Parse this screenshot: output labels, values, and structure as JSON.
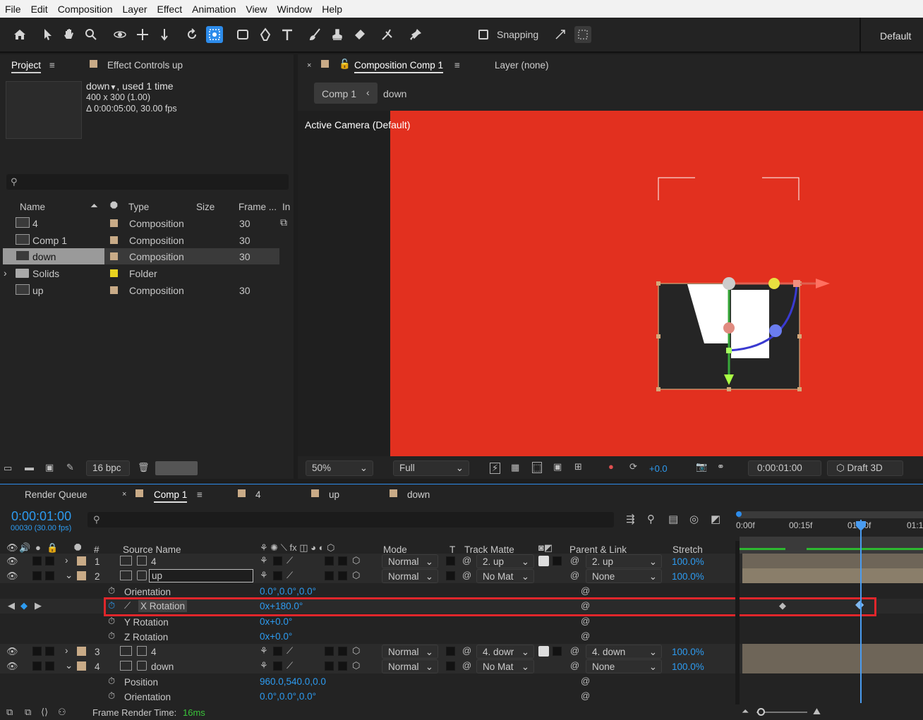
{
  "menu": [
    "File",
    "Edit",
    "Composition",
    "Layer",
    "Effect",
    "Animation",
    "View",
    "Window",
    "Help"
  ],
  "toolbar": {
    "snapping_label": "Snapping",
    "workspace": "Default"
  },
  "project": {
    "tab_label": "Project",
    "effect_tab_label": "Effect Controls up",
    "item_name": "down",
    "item_used": ", used 1 time",
    "item_dims": "400 x 300 (1.00)",
    "item_duration": "Δ 0:00:05:00, 30.00 fps",
    "col_name": "Name",
    "col_type": "Type",
    "col_size": "Size",
    "col_frame": "Frame ...",
    "col_in": "In",
    "items": [
      {
        "name": "4",
        "type": "Composition",
        "frame": "30",
        "color": "#c9ab87"
      },
      {
        "name": "Comp 1",
        "type": "Composition",
        "frame": "30",
        "color": "#c9ab87"
      },
      {
        "name": "down",
        "type": "Composition",
        "frame": "30",
        "color": "#c9ab87"
      },
      {
        "name": "Solids",
        "type": "Folder",
        "frame": "",
        "color": "#e8d21f"
      },
      {
        "name": "up",
        "type": "Composition",
        "frame": "30",
        "color": "#c9ab87"
      }
    ],
    "bpc": "16 bpc"
  },
  "viewer": {
    "tab_label": "Composition Comp 1",
    "layer_tab": "Layer (none)",
    "breadcrumb_comp": "Comp 1",
    "breadcrumb_sub": "down",
    "camera_label": "Active Camera (Default)",
    "zoom": "50%",
    "resolution": "Full",
    "exposure": "+0.0",
    "timecode": "0:00:01:00",
    "renderer": "Draft 3D",
    "bg_color": "#e2301f"
  },
  "timeline": {
    "tabs": [
      "Render Queue",
      "Comp 1",
      "4",
      "up",
      "down"
    ],
    "timecode": "0:00:01:00",
    "frame_info": "00030 (30.00 fps)",
    "ruler": [
      "0:00f",
      "00:15f",
      "01:00f",
      "01:1"
    ],
    "cols": {
      "num": "#",
      "source": "Source Name",
      "mode": "Mode",
      "t": "T",
      "track": "Track Matte",
      "parent": "Parent & Link",
      "stretch": "Stretch"
    },
    "layers": [
      {
        "num": "1",
        "name": "4",
        "mode": "Normal",
        "matte": "2. up",
        "parent": "2. up",
        "stretch": "100.0%"
      },
      {
        "num": "2",
        "name": "up",
        "mode": "Normal",
        "matte": "No Mat",
        "parent": "None",
        "stretch": "100.0%"
      },
      {
        "num": "3",
        "name": "4",
        "mode": "Normal",
        "matte": "4. dowr",
        "parent": "4. down",
        "stretch": "100.0%"
      },
      {
        "num": "4",
        "name": "down",
        "mode": "Normal",
        "matte": "No Mat",
        "parent": "None",
        "stretch": "100.0%"
      }
    ],
    "props_up": [
      {
        "name": "Orientation",
        "value": "0.0°,0.0°,0.0°"
      },
      {
        "name": "X Rotation",
        "value": "0x+180.0°"
      },
      {
        "name": "Y Rotation",
        "value": "0x+0.0°"
      },
      {
        "name": "Z Rotation",
        "value": "0x+0.0°"
      }
    ],
    "props_down": [
      {
        "name": "Position",
        "value": "960.0,540.0,0.0"
      },
      {
        "name": "Orientation",
        "value": "0.0°,0.0°,0.0°"
      }
    ],
    "render_time_label": "Frame Render Time:",
    "render_time_value": "16ms"
  }
}
